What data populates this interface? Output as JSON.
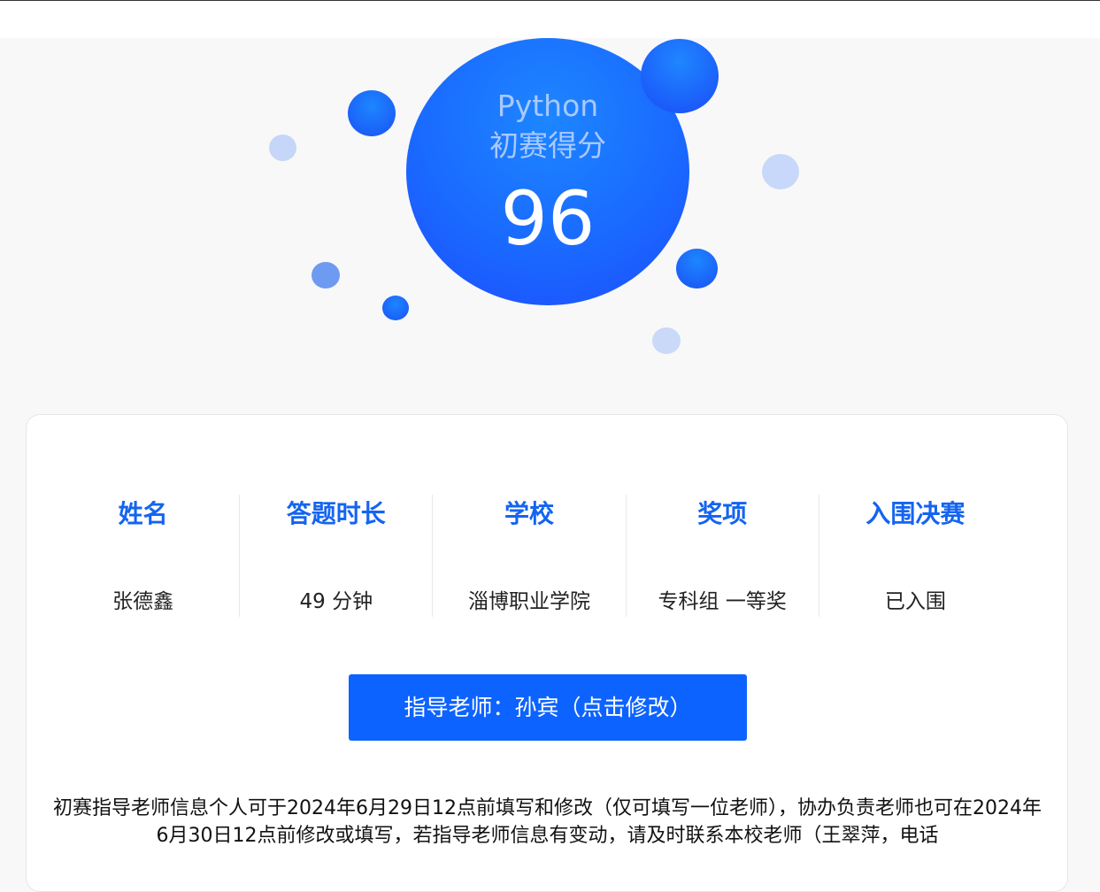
{
  "score": {
    "subject": "Python",
    "label": "初赛得分",
    "value": "96"
  },
  "info": [
    {
      "label": "姓名",
      "value": "张德鑫"
    },
    {
      "label": "答题时长",
      "value": "49 分钟"
    },
    {
      "label": "学校",
      "value": "淄博职业学院"
    },
    {
      "label": "奖项",
      "value": "专科组 一等奖"
    },
    {
      "label": "入围决赛",
      "value": "已入围"
    }
  ],
  "teacher_button": {
    "label": "指导老师：孙宾（点击修改）"
  },
  "notice": "初赛指导老师信息个人可于2024年6月29日12点前填写和修改（仅可填写一位老师），协办负责老师也可在2024年6月30日12点前修改或填写，若指导老师信息有变动，请及时联系本校老师（王翠萍，电话",
  "colors": {
    "accent": "#0d63ff",
    "heading": "#1464f0",
    "bubble_light": "#c6d6f8"
  }
}
